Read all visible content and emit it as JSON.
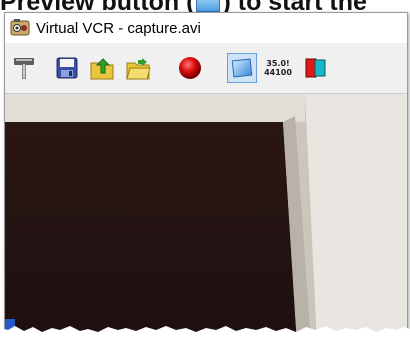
{
  "caption": {
    "text_before": "Preview button (",
    "text_after": ") to start the"
  },
  "window": {
    "title": "Virtual VCR - capture.avi"
  },
  "toolbar": {
    "buttons": [
      {
        "icon": "wrench-hammer-icon",
        "name": "settings"
      },
      {
        "icon": "floppy-disk-icon",
        "name": "save"
      },
      {
        "icon": "folder-up-icon",
        "name": "open-up"
      },
      {
        "icon": "folder-open-icon",
        "name": "open"
      },
      {
        "icon": "record-icon",
        "name": "record"
      },
      {
        "icon": "preview-icon",
        "name": "preview",
        "pressed": true
      },
      {
        "icon": "audio-format-icon",
        "name": "audio-format"
      },
      {
        "icon": "color-format-icon",
        "name": "color-format"
      }
    ],
    "audio_format_line1": "35.0!",
    "audio_format_line2": "44100"
  },
  "colors": {
    "record_red": "#e01010",
    "preview_blue": "#6ab4f0",
    "pressed_border": "#6f9fd8"
  }
}
